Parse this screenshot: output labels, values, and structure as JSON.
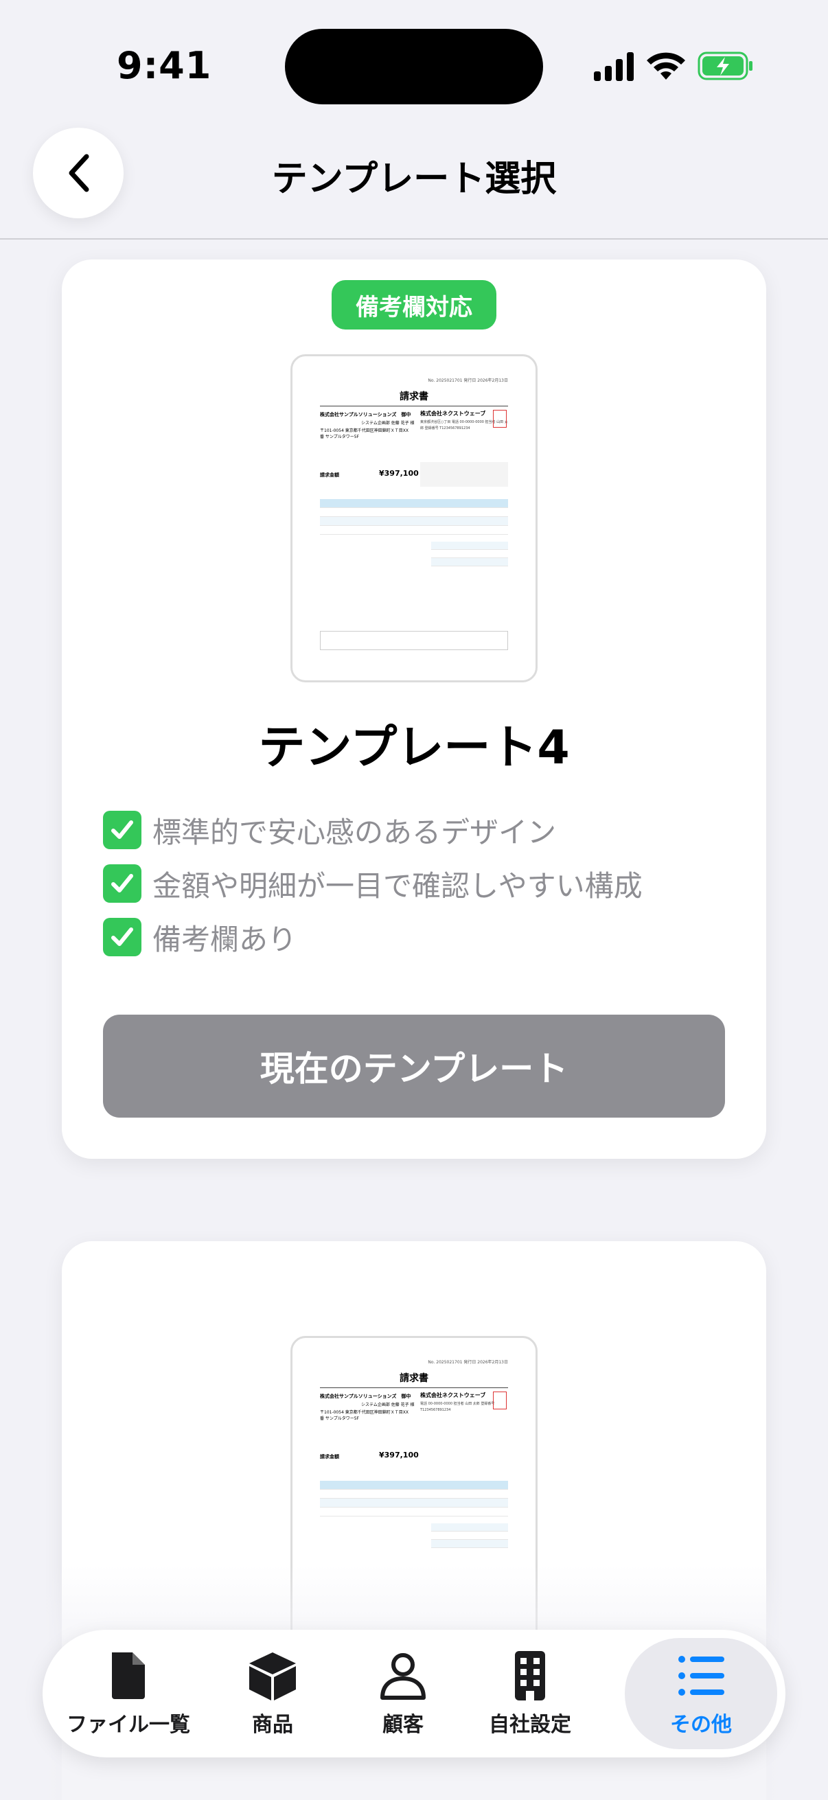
{
  "status_bar": {
    "time": "9:41"
  },
  "nav": {
    "title": "テンプレート選択"
  },
  "cards": [
    {
      "badge": "備考欄対応",
      "preview": {
        "doc_title": "請求書",
        "header_meta": "No. 2025021701 発行日 2026年2月13日",
        "client": "株式会社サンプルソリューションズ　御中",
        "client_contact": "システム企画部 佐藤 花子 様",
        "client_address": "〒101-0054 東京都千代田区神田錦町ＸＴ目XX番 サンプルタワー5F",
        "seller": "株式会社ネクストウェーブ",
        "seller_info": "東京都渋谷区○丁目 電話 00-0000-0000 担当者 山田 太郎 登録番号 T1234567891234",
        "total_label": "請求金額",
        "total": "¥397,100"
      },
      "title": "テンプレート4",
      "features": [
        "標準的で安心感のあるデザイン",
        "金額や明細が一目で確認しやすい構成",
        "備考欄あり"
      ],
      "button": "現在のテンプレート"
    },
    {
      "preview": {
        "doc_title": "請求書",
        "header_meta": "No. 2025021701 発行日 2026年2月13日",
        "client": "株式会社サンプルソリューションズ　御中",
        "client_contact": "システム企画部 佐藤 花子 様",
        "client_address": "〒101-0054 東京都千代田区神田錦町ＸＴ目XX番 サンプルタワー5F",
        "seller": "株式会社ネクストウェーブ",
        "seller_info": "電話 00-0000-0000 担当者 山田 太郎 登録番号 T1234567891234",
        "total_label": "請求金額",
        "total": "¥397,100"
      }
    }
  ],
  "tabs": [
    {
      "label": "ファイル一覧",
      "icon": "document-icon"
    },
    {
      "label": "商品",
      "icon": "box-icon"
    },
    {
      "label": "顧客",
      "icon": "person-icon"
    },
    {
      "label": "自社設定",
      "icon": "building-icon"
    },
    {
      "label": "その他",
      "icon": "list-icon",
      "active": true
    }
  ],
  "colors": {
    "accent": "#0a84ff",
    "badge": "#34c759",
    "button_disabled": "#8e8e93"
  }
}
